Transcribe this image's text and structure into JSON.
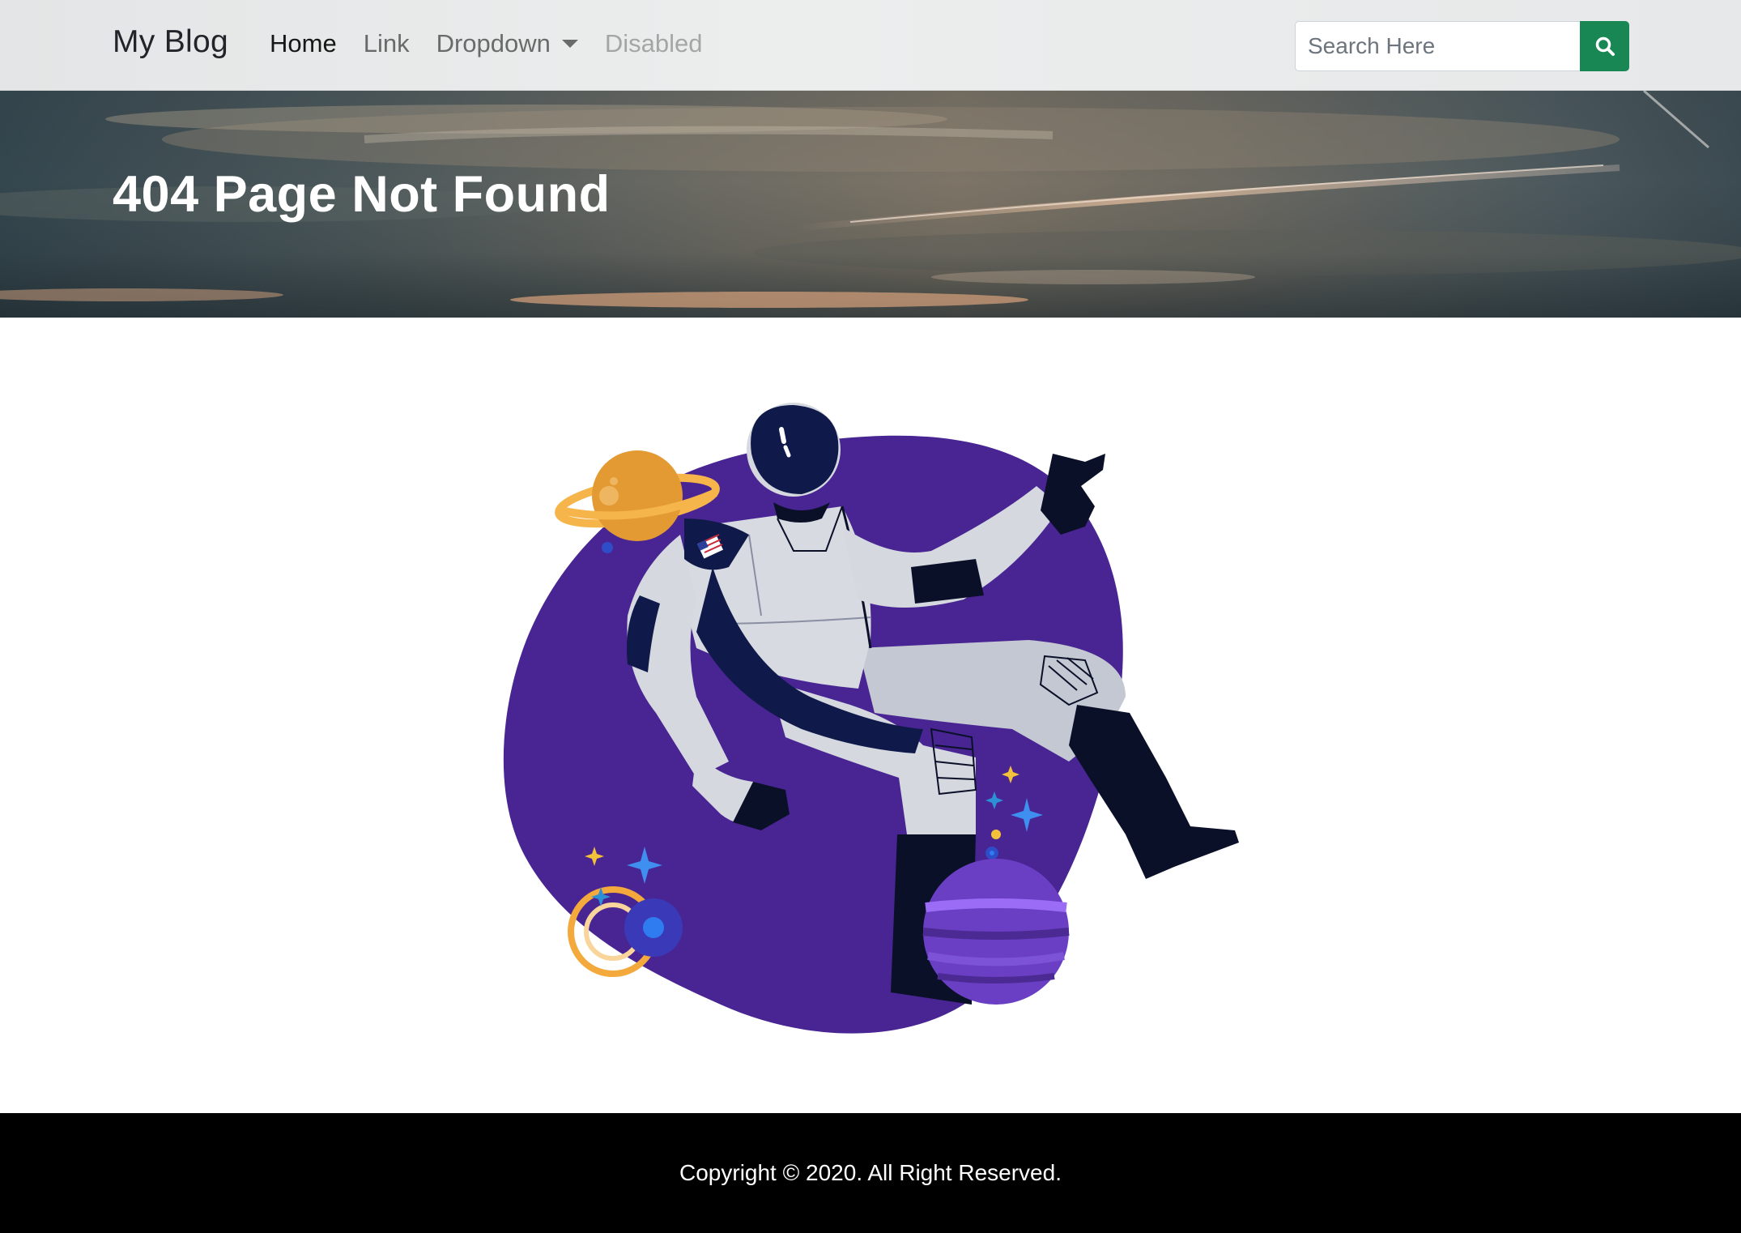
{
  "navbar": {
    "brand": "My Blog",
    "links": [
      {
        "label": "Home",
        "state": "active"
      },
      {
        "label": "Link",
        "state": "normal"
      },
      {
        "label": "Dropdown",
        "state": "dropdown"
      },
      {
        "label": "Disabled",
        "state": "disabled"
      }
    ],
    "search": {
      "placeholder": "Search Here",
      "value": "",
      "button_icon": "search-icon",
      "button_color": "#198754"
    }
  },
  "hero": {
    "title": "404 Page Not Found"
  },
  "illustration": {
    "subject": "astronaut-floating-in-space",
    "blob_color": "#482593"
  },
  "footer": {
    "text": "Copyright © 2020. All Right Reserved."
  }
}
